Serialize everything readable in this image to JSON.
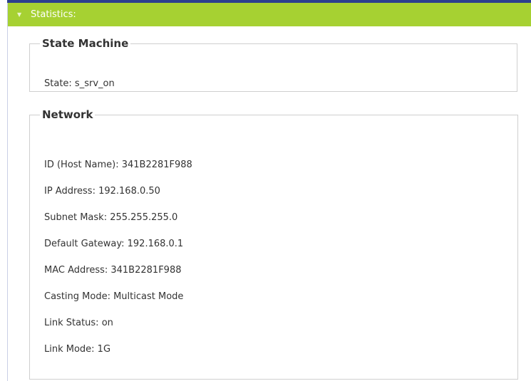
{
  "panel": {
    "title": "Statistics:"
  },
  "state_machine": {
    "legend": "State Machine",
    "state": "State: s_srv_on"
  },
  "network": {
    "legend": "Network",
    "rows": [
      "ID (Host Name): 341B2281F988",
      "IP Address: 192.168.0.50",
      "Subnet Mask: 255.255.255.0",
      "Default Gateway: 192.168.0.1",
      "MAC Address: 341B2281F988",
      "Casting Mode: Multicast Mode",
      "Link Status: on",
      "Link Mode: 1G"
    ]
  },
  "colors": {
    "header_bg": "#a6d132",
    "top_rule": "#2b3f8f",
    "text": "#333333",
    "border": "#cfcfcf"
  },
  "icons": {
    "collapse": "triangle-down-icon"
  }
}
